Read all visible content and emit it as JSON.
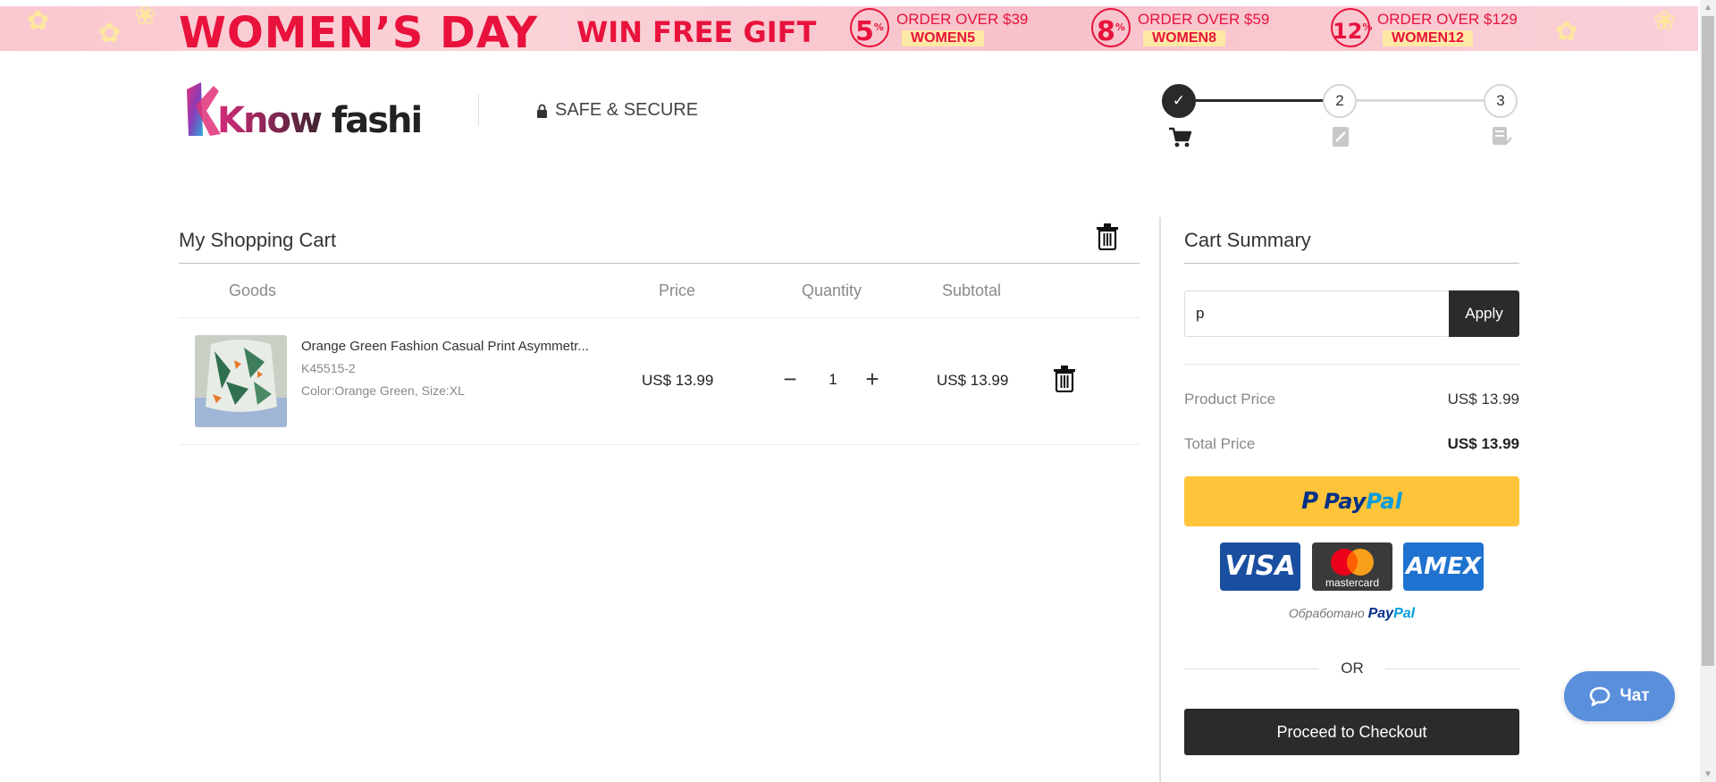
{
  "promo": {
    "title": "WOMEN’S DAY",
    "gift": "WIN FREE GIFT",
    "offers": [
      {
        "pct": "5",
        "condition": "ORDER OVER $39",
        "code": "WOMEN5"
      },
      {
        "pct": "8",
        "condition": "ORDER OVER $59",
        "code": "WOMEN8"
      },
      {
        "pct": "12",
        "condition": "ORDER OVER $129",
        "code": "WOMEN12"
      }
    ]
  },
  "header": {
    "logo_text": "Know fashion style",
    "secure_label": "SAFE & SECURE",
    "steps": [
      {
        "label": "✓",
        "state": "done",
        "icon": "cart-icon"
      },
      {
        "label": "2",
        "state": "todo",
        "icon": "form-icon"
      },
      {
        "label": "3",
        "state": "todo",
        "icon": "confirm-icon"
      }
    ]
  },
  "cart": {
    "title": "My Shopping Cart",
    "columns": {
      "goods": "Goods",
      "price": "Price",
      "quantity": "Quantity",
      "subtotal": "Subtotal"
    },
    "items": [
      {
        "name": "Orange Green Fashion Casual Print Asymmetr...",
        "sku": "K45515-2",
        "attrs": "Color:Orange Green, Size:XL",
        "price": "US$ 13.99",
        "quantity": "1",
        "subtotal": "US$ 13.99"
      }
    ]
  },
  "summary": {
    "title": "Cart Summary",
    "coupon_value": "p",
    "apply_label": "Apply",
    "product_price_label": "Product Price",
    "product_price": "US$ 13.99",
    "total_price_label": "Total Price",
    "total_price": "US$ 13.99",
    "paypal_label_a": "Pay",
    "paypal_label_b": "Pal",
    "cards": {
      "visa": "VISA",
      "mastercard": "mastercard",
      "amex": "AMEX"
    },
    "processed_by": "Обработано",
    "processed_brand_a": "Pay",
    "processed_brand_b": "Pal",
    "or_label": "OR",
    "checkout_label": "Proceed to Checkout"
  },
  "chat": {
    "label": "Чат"
  },
  "colors": {
    "accent_dark": "#2b2b2b",
    "paypal_yellow": "#ffc439",
    "promo_red": "#e8123c",
    "chat_blue": "#5a8fdc"
  }
}
